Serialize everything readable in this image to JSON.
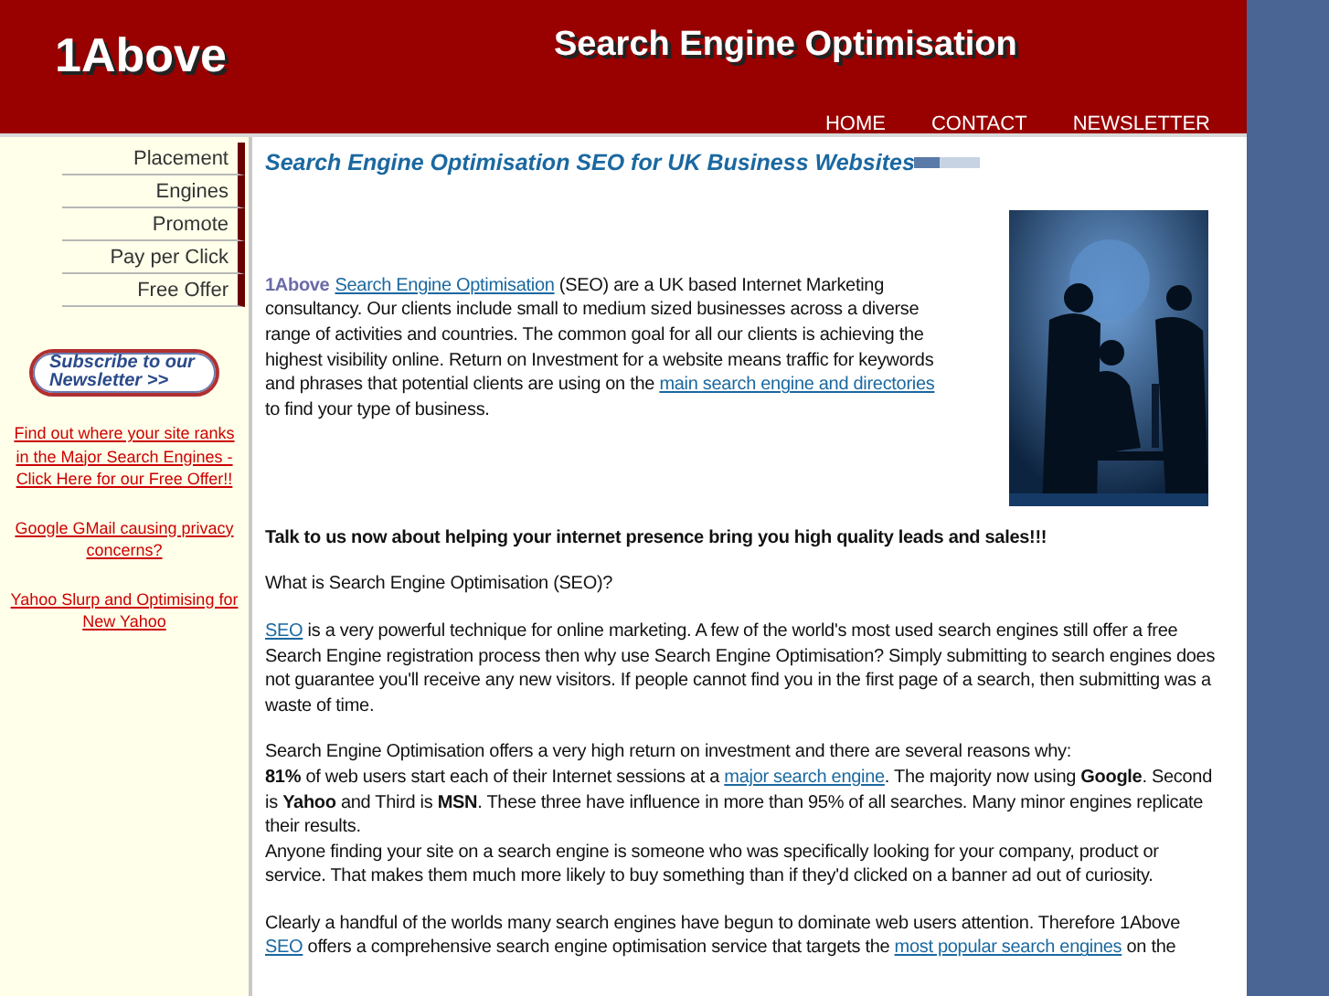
{
  "header": {
    "logo": "1Above",
    "title": "Search Engine Optimisation",
    "nav": [
      {
        "label": "HOME"
      },
      {
        "label": "CONTACT"
      },
      {
        "label": "NEWSLETTER"
      }
    ]
  },
  "sidebar": {
    "menu": [
      {
        "label": "Placement"
      },
      {
        "label": "Engines"
      },
      {
        "label": "Promote"
      },
      {
        "label": "Pay per Click"
      },
      {
        "label": "Free Offer"
      }
    ],
    "subscribe_button": "Subscribe to our Newsletter >>",
    "links": [
      "Find out where your site ranks in the Major Search Engines - Click Here for our Free Offer!!",
      "Google GMail causing privacy concerns?",
      "Yahoo Slurp and Optimising for New Yahoo"
    ]
  },
  "content": {
    "heading": "Search Engine Optimisation SEO for UK Business Websites",
    "intro": [
      {
        "kind": "brand",
        "text": "1Above"
      },
      {
        "kind": "link",
        "text": "Search Engine Optimisation"
      },
      {
        "kind": "text",
        "text": " (SEO) are a UK based Internet Marketing consultancy. Our clients include small to medium sized businesses across a diverse range of activities and countries. The common goal for all our clients is achieving the highest visibility online. Return on Investment for a website means traffic for keywords and phrases that potential clients are using on the "
      },
      {
        "kind": "link",
        "text": "main search engine and directories"
      },
      {
        "kind": "text",
        "text": " to find your type of business."
      }
    ],
    "paragraphs": [
      {
        "lines": [
          [
            {
              "kind": "bold",
              "text": "Talk to us now about helping your internet presence bring you high quality leads and sales!!!"
            }
          ]
        ]
      },
      {
        "lines": [
          [
            {
              "kind": "text",
              "text": "What is Search Engine Optimisation (SEO)?"
            }
          ]
        ]
      },
      {
        "lines": [
          [
            {
              "kind": "link",
              "text": "SEO"
            },
            {
              "kind": "text",
              "text": " is a very powerful technique for online marketing. A few of the world's most used search engines still offer a free Search Engine registration process then why use Search Engine Optimisation? Simply submitting to search engines does not guarantee you'll receive any new visitors. If people cannot find you in the first page of a search, then submitting was a waste of time."
            }
          ]
        ]
      },
      {
        "lines": [
          [
            {
              "kind": "text",
              "text": "Search Engine Optimisation offers a very high return on investment and there are several reasons why:"
            }
          ],
          [
            {
              "kind": "bold",
              "text": "81%"
            },
            {
              "kind": "text",
              "text": " of web users start each of their Internet sessions at a "
            },
            {
              "kind": "link",
              "text": "major search engine"
            },
            {
              "kind": "text",
              "text": ". The majority now using "
            },
            {
              "kind": "bold",
              "text": "Google"
            },
            {
              "kind": "text",
              "text": ". Second is "
            },
            {
              "kind": "bold",
              "text": "Yahoo"
            },
            {
              "kind": "text",
              "text": " and Third is "
            },
            {
              "kind": "bold",
              "text": "MSN"
            },
            {
              "kind": "text",
              "text": ". These three have influence in more than 95% of all searches. Many minor engines replicate their results."
            }
          ],
          [
            {
              "kind": "text",
              "text": "Anyone finding your site on a search engine is someone who was specifically looking for your company, product or service. That makes them much more likely to buy something than if they'd clicked on a banner ad out of curiosity."
            }
          ]
        ]
      },
      {
        "lines": [
          [
            {
              "kind": "text",
              "text": "Clearly a handful of the worlds many search engines have begun to dominate web users attention. Therefore 1Above "
            },
            {
              "kind": "link",
              "text": "SEO"
            },
            {
              "kind": "text",
              "text": " offers a comprehensive search engine optimisation service that targets the "
            },
            {
              "kind": "link",
              "text": "most popular search engines"
            },
            {
              "kind": "text",
              "text": " on the"
            }
          ]
        ]
      }
    ]
  }
}
